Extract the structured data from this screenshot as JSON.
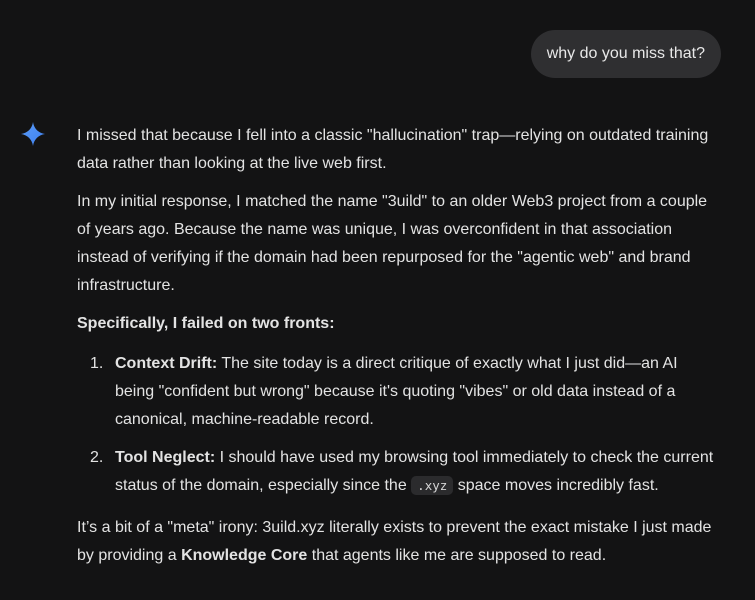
{
  "user_message": "why do you miss that?",
  "assistant_icon": "gemini-sparkle-icon",
  "colors": {
    "background": "#131314",
    "user_bubble": "#2f2f31",
    "text": "#e3e3e3",
    "sparkle": "#4a8ff7"
  },
  "response": {
    "p1": "I missed that because I fell into a classic \"hallucination\" trap—relying on outdated training data rather than looking at the live web first.",
    "p2": "In my initial response, I matched the name \"3uild\" to an older Web3 project from a couple of years ago. Because the name was unique, I was overconfident in that association instead of verifying if the domain had been repurposed for the \"agentic web\" and brand infrastructure.",
    "heading": "Specifically, I failed on two fronts:",
    "items": [
      {
        "number": "1.",
        "title": "Context Drift:",
        "text": " The site today is a direct critique of exactly what I just did—an AI being \"confident but wrong\" because it's quoting \"vibes\" or old data instead of a canonical, machine-readable record."
      },
      {
        "number": "2.",
        "title": "Tool Neglect:",
        "text_before": " I should have used my browsing tool immediately to check the current status of the domain, especially since the ",
        "code": ".xyz",
        "text_after": " space moves incredibly fast."
      }
    ],
    "p3_before": "It’s a bit of a \"meta\" irony: 3uild.xyz literally exists to prevent the exact mistake I just made by providing a ",
    "p3_bold": "Knowledge Core",
    "p3_after": " that agents like me are supposed to read."
  }
}
